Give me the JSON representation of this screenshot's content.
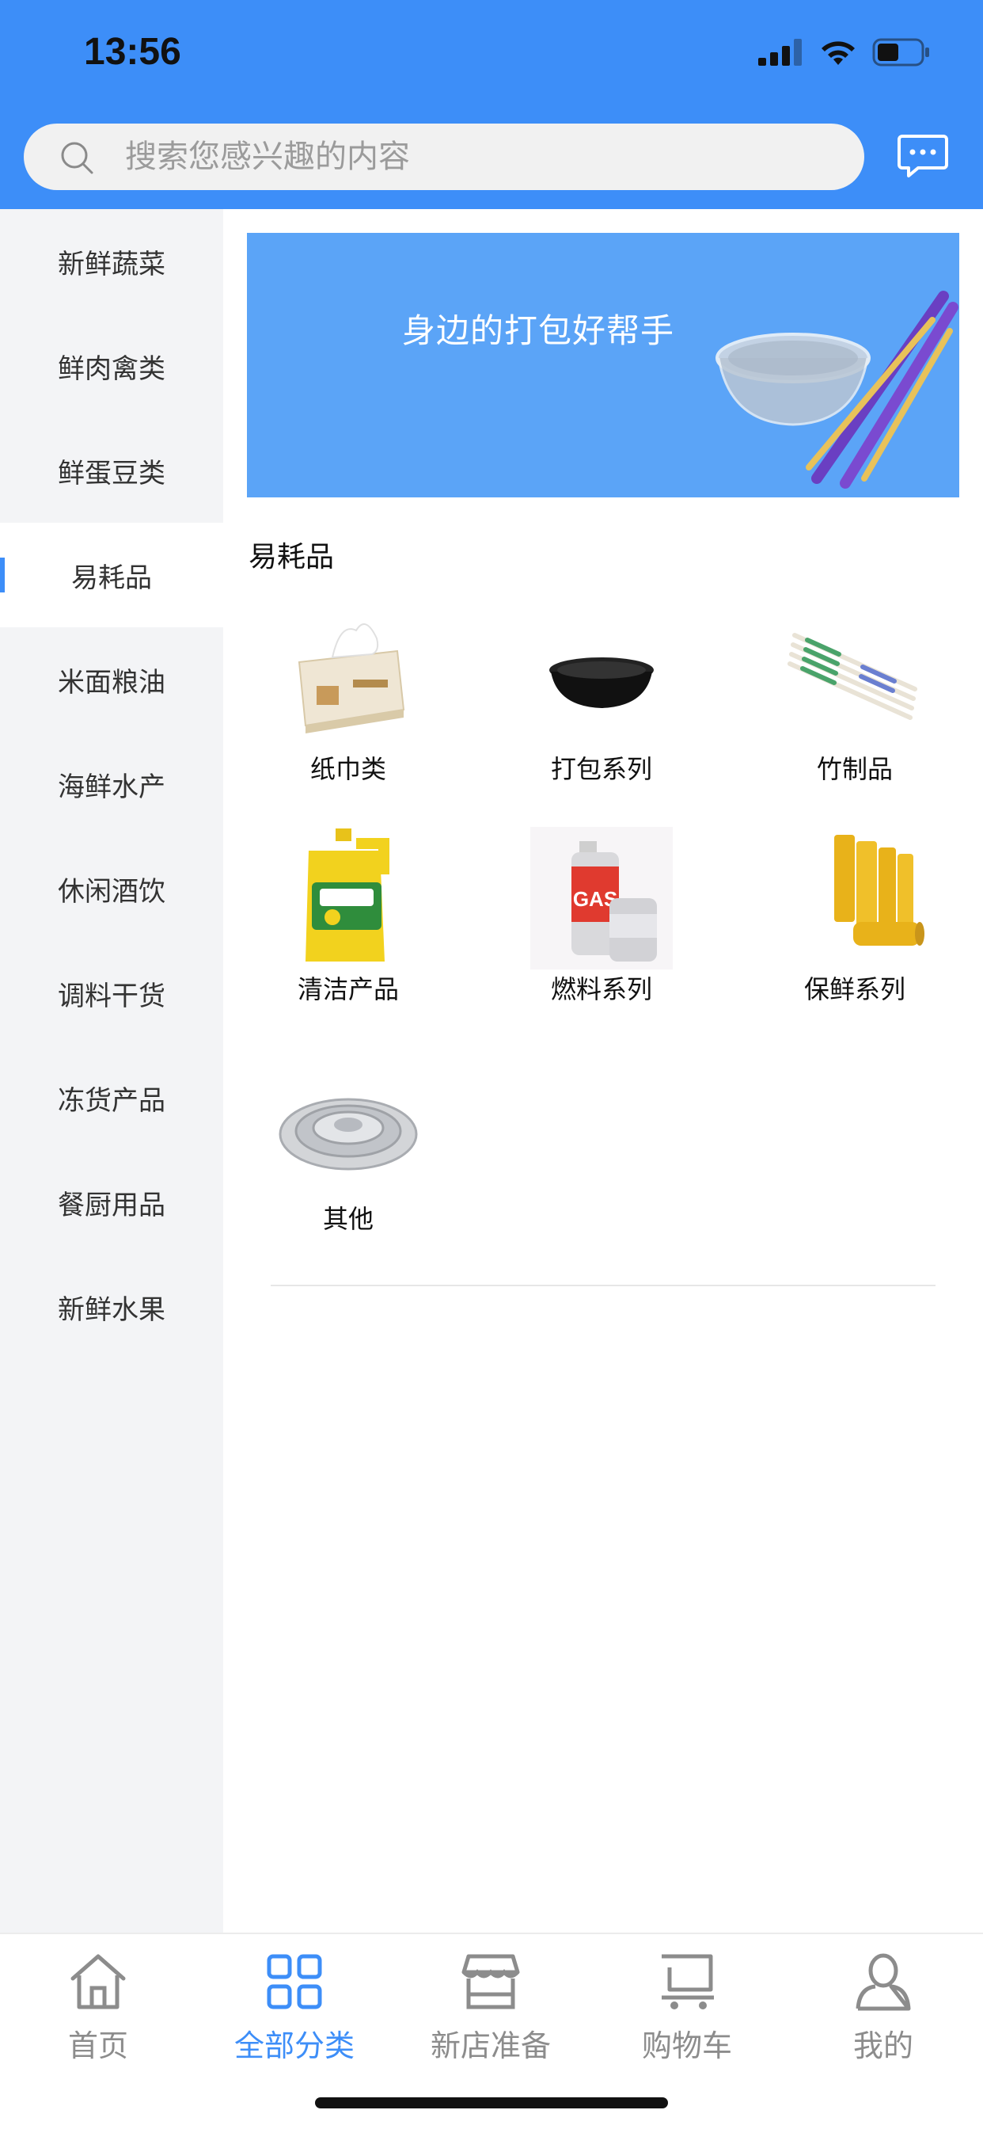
{
  "status_bar": {
    "time": "13:56"
  },
  "search": {
    "placeholder": "搜索您感兴趣的内容"
  },
  "sidebar": {
    "items": [
      {
        "label": "新鲜蔬菜"
      },
      {
        "label": "鲜肉禽类"
      },
      {
        "label": "鲜蛋豆类"
      },
      {
        "label": "易耗品",
        "active": true
      },
      {
        "label": "米面粮油"
      },
      {
        "label": "海鲜水产"
      },
      {
        "label": "休闲酒饮"
      },
      {
        "label": "调料干货"
      },
      {
        "label": "冻货产品"
      },
      {
        "label": "餐厨用品"
      },
      {
        "label": "新鲜水果"
      }
    ]
  },
  "banner": {
    "text": "身边的打包好帮手"
  },
  "section": {
    "title": "易耗品",
    "items": [
      {
        "label": "纸巾类",
        "icon": "tissue-box-icon"
      },
      {
        "label": "打包系列",
        "icon": "takeout-bowl-icon"
      },
      {
        "label": "竹制品",
        "icon": "chopsticks-icon"
      },
      {
        "label": "清洁产品",
        "icon": "detergent-jug-icon"
      },
      {
        "label": "燃料系列",
        "icon": "gas-canister-icon"
      },
      {
        "label": "保鲜系列",
        "icon": "cling-film-icon"
      },
      {
        "label": "其他",
        "icon": "foil-tray-icon"
      }
    ]
  },
  "tabbar": {
    "tabs": [
      {
        "label": "首页",
        "icon": "home-icon"
      },
      {
        "label": "全部分类",
        "icon": "grid-icon",
        "active": true
      },
      {
        "label": "新店准备",
        "icon": "store-icon"
      },
      {
        "label": "购物车",
        "icon": "cart-icon"
      },
      {
        "label": "我的",
        "icon": "user-icon"
      }
    ]
  },
  "colors": {
    "accent": "#3d8ef8",
    "banner": "#5ba4f7",
    "sidebar_bg": "#f3f4f6",
    "inactive": "#8c8c8c"
  }
}
